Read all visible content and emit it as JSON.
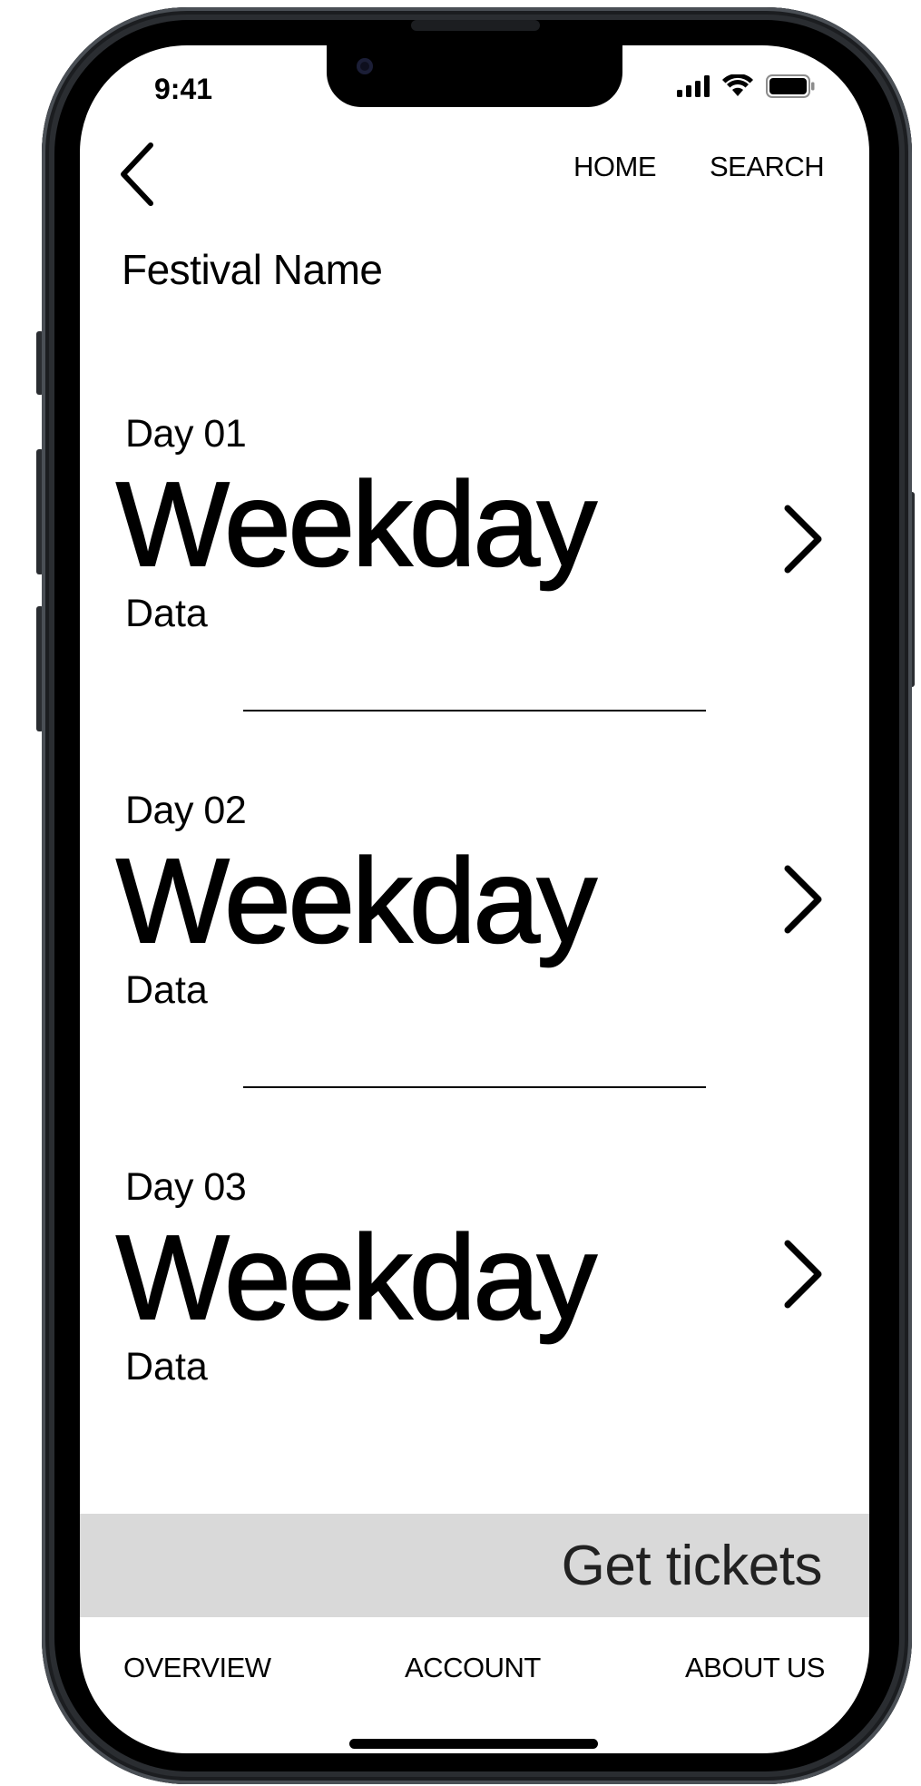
{
  "status_bar": {
    "time": "9:41",
    "icons": [
      "cellular-signal-icon",
      "wifi-icon",
      "battery-icon"
    ]
  },
  "header": {
    "back_icon": "chevron-left-icon",
    "home_label": "HOME",
    "search_label": "SEARCH"
  },
  "festival": {
    "title": "Festival Name"
  },
  "days": [
    {
      "day_label": "Day 01",
      "weekday": "Weekday",
      "data": "Data",
      "icon": "chevron-right-icon"
    },
    {
      "day_label": "Day 02",
      "weekday": "Weekday",
      "data": "Data",
      "icon": "chevron-right-icon"
    },
    {
      "day_label": "Day 03",
      "weekday": "Weekday",
      "data": "Data",
      "icon": "chevron-right-icon"
    }
  ],
  "tickets": {
    "label": "Get tickets",
    "background": "#d9d9d9"
  },
  "bottom_nav": {
    "overview": "OVERVIEW",
    "account": "ACCOUNT",
    "about": "ABOUT US"
  },
  "colors": {
    "text": "#000000",
    "screen_bg": "#ffffff",
    "frame": "#2a2d31"
  }
}
